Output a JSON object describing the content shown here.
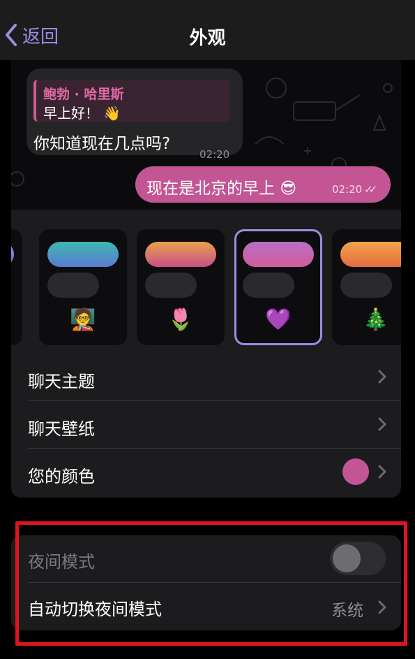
{
  "nav": {
    "back_label": "返回",
    "title": "外观"
  },
  "chat": {
    "incoming": {
      "reply_name": "鲍勃 · 哈里斯",
      "reply_text": "早上好！ 👋",
      "text": "你知道现在几点吗?",
      "time": "02:20"
    },
    "outgoing": {
      "text": "现在是北京的早上 😎",
      "time": "02:20",
      "read_ticks": "✓✓"
    }
  },
  "themes": [
    {
      "id": "theme-partial",
      "gradient": [
        "#9fa0ea",
        "#6a5dd0"
      ],
      "emoji": "",
      "selected": false
    },
    {
      "id": "theme-teal",
      "gradient": [
        "#3fb7b1",
        "#5a7bd2"
      ],
      "emoji": "🧑‍🏫",
      "selected": false
    },
    {
      "id": "theme-sunset",
      "gradient": [
        "#e8a24a",
        "#c94e8a"
      ],
      "emoji": "🌷",
      "selected": false
    },
    {
      "id": "theme-purple",
      "gradient": [
        "#b86fc7",
        "#d15c98"
      ],
      "emoji": "💜",
      "selected": true
    },
    {
      "id": "theme-orange",
      "gradient": [
        "#f0a44d",
        "#e56b3f"
      ],
      "emoji": "🎄",
      "selected": false
    }
  ],
  "settings": {
    "chat_theme": "聊天主题",
    "chat_wallpaper": "聊天壁纸",
    "your_color": "您的颜色",
    "your_color_value": "#c45595"
  },
  "night": {
    "night_mode_label": "夜间模式",
    "night_mode_on": false,
    "auto_switch_label": "自动切换夜间模式",
    "auto_switch_value": "系统"
  },
  "colors": {
    "accent": "#9b8ee6",
    "bubble_out": "#c45595",
    "highlight": "#e0141e"
  }
}
